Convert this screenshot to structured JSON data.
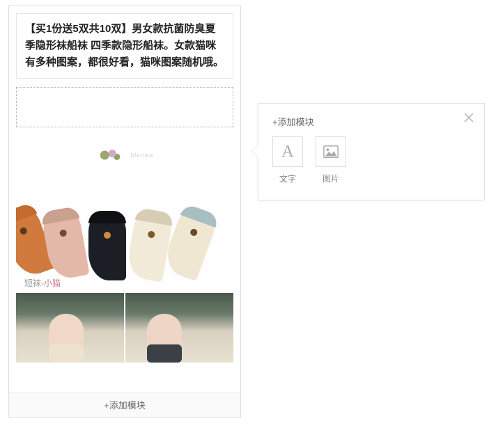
{
  "editor": {
    "text_block": "【买1份送5双共10双】男女款抗菌防臭夏季隐形袜船袜 四季款隐形船袜。女款猫咪有多种图案，都很好看，猫咪图案随机哦。",
    "product_caption_prefix": "短袜-",
    "product_caption_keyword": "小猫",
    "add_module_button": "+添加模块"
  },
  "popover": {
    "title": "+添加模块",
    "tiles": [
      {
        "label": "文字",
        "icon": "text"
      },
      {
        "label": "图片",
        "icon": "image"
      }
    ]
  }
}
